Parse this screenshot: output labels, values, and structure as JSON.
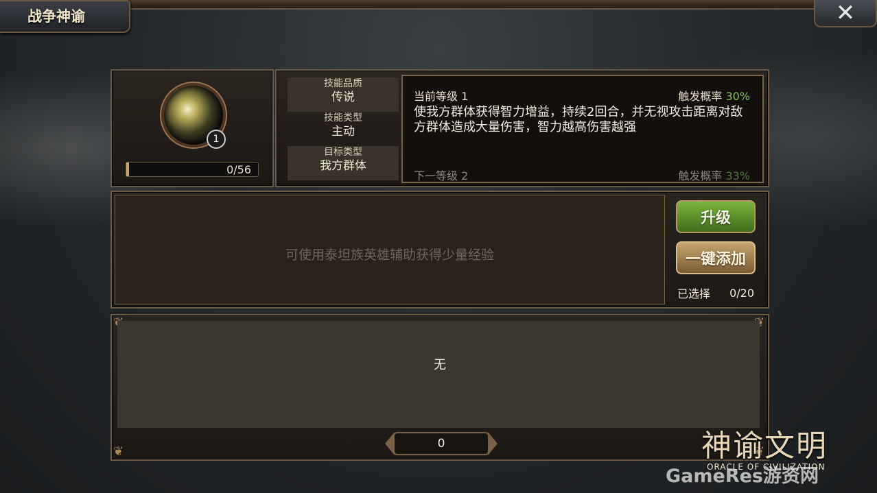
{
  "window": {
    "title": "战争神谕",
    "close_symbol": "✕"
  },
  "skill": {
    "level_badge": "1",
    "exp_text": "0/56",
    "exp_fraction": 0.0,
    "attributes": [
      {
        "key": "技能品质",
        "value": "传说"
      },
      {
        "key": "技能类型",
        "value": "主动"
      },
      {
        "key": "目标类型",
        "value": "我方群体"
      }
    ],
    "description": {
      "current_level": "当前等级 1",
      "trigger_label": "触发概率",
      "current_rate": "30%",
      "text": "使我方群体获得智力增益，持续2回合，并无视攻击距离对敌方群体造成大量伤害，智力越高伤害越强",
      "next_level": "下一等级 2",
      "next_rate": "33%"
    }
  },
  "materials": {
    "hint": "可使用泰坦族英雄辅助获得少量经验",
    "upgrade_label": "升级",
    "quick_add_label": "一键添加",
    "selected_label": "已选择",
    "selected_count": "0/20"
  },
  "list": {
    "empty_text": "无",
    "page": "0"
  },
  "branding": {
    "logo": "神谕文明",
    "logo_sub": "ORACLE OF CIVILIZATION",
    "watermark": "GameRes游资网"
  },
  "colors": {
    "green_rate": "#7ec84f",
    "upgrade_btn": "#6aa332",
    "add_btn": "#b39058",
    "frame": "#6d5a44"
  },
  "icons": {
    "close": "close-icon",
    "orb": "skill-orb-icon"
  }
}
